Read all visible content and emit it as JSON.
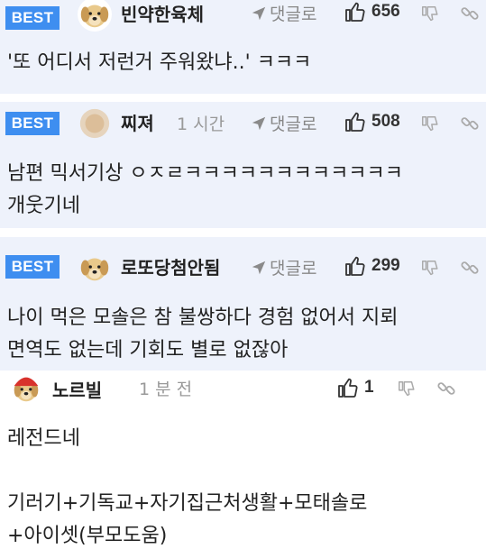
{
  "comments": [
    {
      "best_label": "BEST",
      "nickname": "빈약한육체",
      "time": "",
      "reply_label": "댓글로",
      "likes": "656",
      "avatar": "dog-avatar-icon",
      "text": "'또 어디서 저런거 주워왔냐..' ㅋㅋㅋ"
    },
    {
      "best_label": "BEST",
      "nickname": "찌져",
      "time": "1 시간",
      "reply_label": "댓글로",
      "likes": "508",
      "avatar": "blurred-avatar-icon",
      "text": "남편 믹서기상 ㅇㅈㄹㅋㅋㅋㅋㅋㅋㅋㅋㅋㅋㅋㅋ\n개웃기네"
    },
    {
      "best_label": "BEST",
      "nickname": "로또당첨안됨",
      "time": "",
      "reply_label": "댓글로",
      "likes": "299",
      "avatar": "dog-avatar-icon",
      "text": "나이 먹은 모솔은 참 불쌍하다 경험 없어서 지뢰\n면역도 없는데 기회도 별로 없잖아"
    },
    {
      "nickname": "노르빌",
      "time": "1 분 전",
      "likes": "1",
      "avatar": "dog-with-red-hat-avatar-icon",
      "text": "레전드네\n\n기러기+기독교+자기집근처생활+모태솔로\n+아이셋(부모도움)"
    }
  ],
  "colors": {
    "best_badge": "#3e8ef0",
    "best_background": "#eef2fb",
    "muted_text": "#999999"
  }
}
